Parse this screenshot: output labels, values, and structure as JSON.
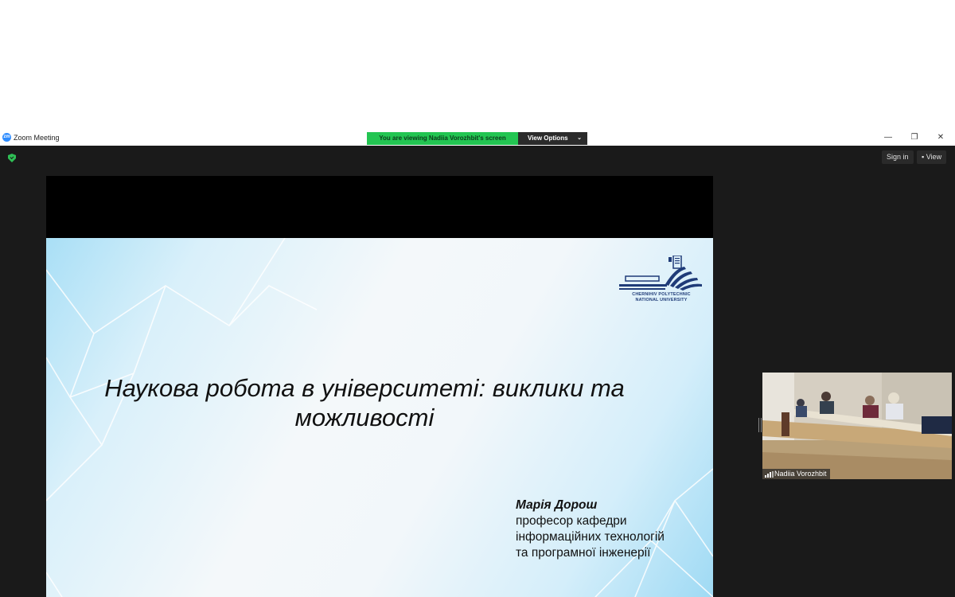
{
  "window": {
    "title": "Zoom Meeting",
    "app_icon": "zoom-logo-icon",
    "app_icon_text": "zm"
  },
  "share_banner": {
    "status": "You are viewing Nadiia Vorozhbit's screen",
    "view_options": "View Options",
    "status_color": "#23c552"
  },
  "toolbar": {
    "sign_in": "Sign in",
    "view": "View"
  },
  "window_controls": {
    "minimize": "—",
    "restore": "❐",
    "close": "✕"
  },
  "slide": {
    "university_name_line1": "CHERNIHIV POLYTECHNIC",
    "university_name_line2": "NATIONAL UNIVERSITY",
    "title_line1": "Наукова робота в університеті: виклики та",
    "title_line2": "можливості",
    "author_name": "Марія Дорош",
    "author_line1": "професор кафедри",
    "author_line2": "інформаційних технологій",
    "author_line3": "та програмної інженерії"
  },
  "participant": {
    "name": "Nadiia Vorozhbit"
  },
  "colors": {
    "meeting_bg": "#1a1a1a",
    "accent": "#2d8cff",
    "logo_blue": "#1f3b78"
  }
}
